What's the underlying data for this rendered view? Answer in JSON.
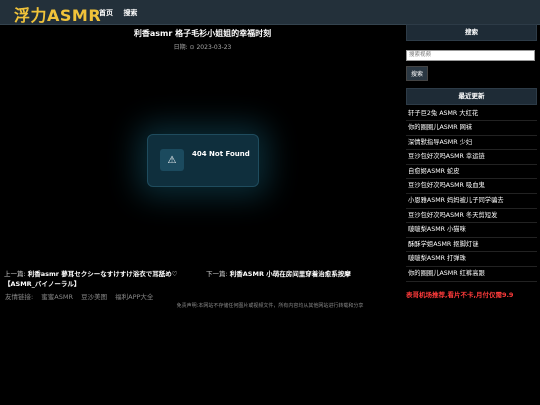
{
  "header": {
    "logo": "浮力ASMR",
    "nav": [
      "首页",
      "搜索"
    ]
  },
  "post": {
    "title": "利香asmr 格子毛衫小姐姐的幸福时刻",
    "date": "日期: ⊙ 2023-03-23"
  },
  "error_card": {
    "icon": "⚠",
    "message": "404 Not Found"
  },
  "prev": {
    "label": "上一篇:",
    "title": "利香asmr 蓼耳セクシーなすけすけ浴衣で耳舐め♡【ASMR_バイノーラル】"
  },
  "next": {
    "label": "下一篇:",
    "title": "利香ASMR 小萌在房间里穿着治愈系按摩"
  },
  "friend_links": {
    "label": "友情链接:",
    "items": [
      "蜜蜜ASMR",
      "豆沙美图",
      "福利APP大全"
    ]
  },
  "footer": "免责声明:本网站不存储任何图片或视频文件，所有内容均从其他网站进行转载和分享",
  "sidebar": {
    "search_title": "搜索",
    "search_placeholder": "搜索视频",
    "search_button": "搜索",
    "recent_title": "最近更新",
    "recent": [
      "轩子巨2兔 ASMR 大红花",
      "你的圈圈儿ASMR 网袜",
      "深情默指导ASMR 少妇",
      "豆沙包好次吗ASMR 幸运链",
      "自愈姬ASMR 蛇皮",
      "豆沙包好次吗ASMR 吸血鬼",
      "小恩雅ASMR 妈妈被儿子同学骗去",
      "豆沙包好次吗ASMR 冬天剪短发",
      "啵啵梨ASMR 小猫咪",
      "酥酥学姐ASMR 抠脚灯谜",
      "啵啵梨ASMR 打弹珠",
      "你的圈圈儿ASMR 红裤高跟"
    ],
    "promo": "表哥机场推荐,看片不卡,月付仅需9.9"
  }
}
